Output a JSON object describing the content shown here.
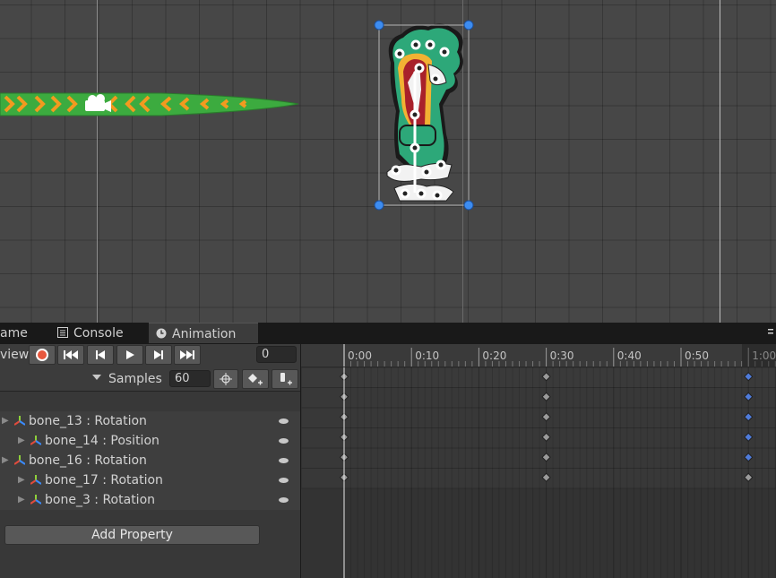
{
  "tabs": [
    {
      "label": "ame",
      "icon": "",
      "active": false
    },
    {
      "label": "Console",
      "icon": "console-icon",
      "active": false
    },
    {
      "label": "Animation",
      "icon": "clock-icon",
      "active": true
    }
  ],
  "toolbar": {
    "preview_label": "view",
    "frame_value": "0"
  },
  "samples": {
    "label": "Samples",
    "value": "60"
  },
  "properties": [
    {
      "label": "bone_13 : Rotation"
    },
    {
      "label": "bone_14 : Position"
    },
    {
      "label": "bone_16 : Rotation"
    },
    {
      "label": "bone_17 : Rotation"
    },
    {
      "label": "bone_3 : Rotation"
    }
  ],
  "add_property_label": "Add Property",
  "timeline": {
    "ticks": [
      "0:00",
      "0:10",
      "0:20",
      "0:30",
      "0:40",
      "0:50",
      "1:00"
    ],
    "playhead_frame": 0
  },
  "colors": {
    "record": "#e8573d",
    "keyframe": "#9a9a9a",
    "keyframe_selected": "#4f7bd9",
    "bone_icon_x": "#e24b3b",
    "bone_icon_y": "#8ed13a",
    "bone_icon_z": "#3b8bff"
  }
}
